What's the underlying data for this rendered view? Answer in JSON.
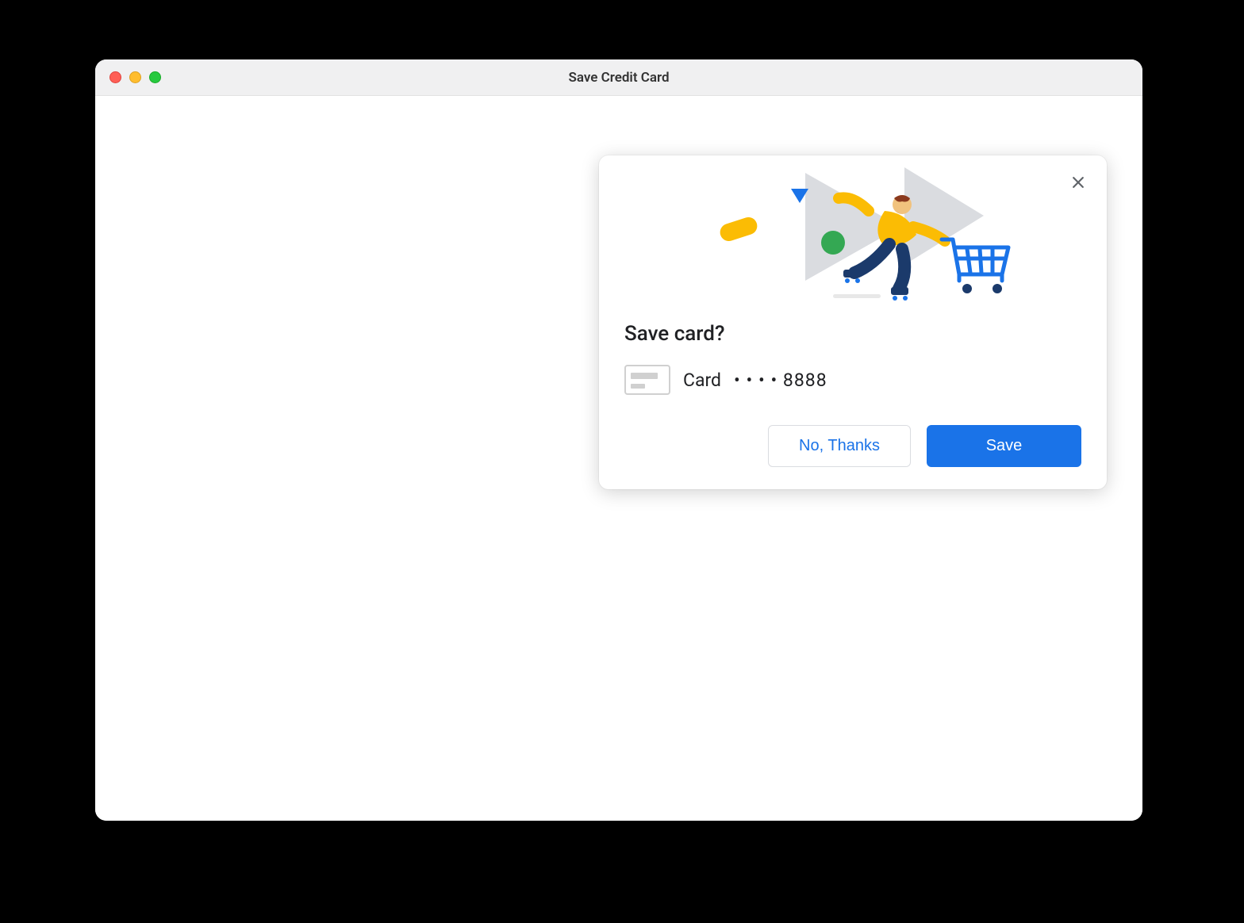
{
  "window": {
    "title": "Save Credit Card"
  },
  "dialog": {
    "title": "Save card?",
    "card": {
      "label": "Card",
      "masked_prefix": "• • • •",
      "last4": "8888"
    },
    "actions": {
      "secondary_label": "No, Thanks",
      "primary_label": "Save"
    }
  },
  "icons": {
    "close": "close-icon",
    "credit_card": "credit-card-icon",
    "illustration": "shopping-skater-illustration"
  },
  "colors": {
    "primary_blue": "#1a73e8",
    "google_yellow": "#fbbc04",
    "google_green": "#34a853",
    "illustration_grey": "#dadce0",
    "text": "#202124"
  }
}
